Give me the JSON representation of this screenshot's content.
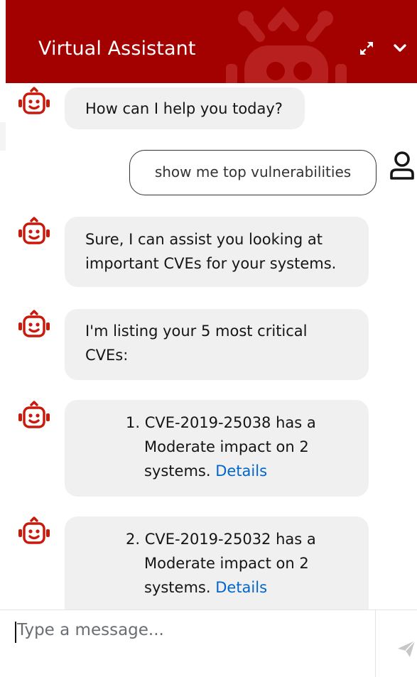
{
  "header": {
    "title": "Virtual Assistant",
    "background_color": "#a30000",
    "expand_icon": "expand-icon",
    "collapse_icon": "chevron-down-icon"
  },
  "messages": [
    {
      "sender": "bot",
      "text": "How can I help you today?"
    },
    {
      "sender": "user",
      "text": "show me top vulnerabilities"
    },
    {
      "sender": "bot",
      "lines": [
        "Sure, I can assist you looking at",
        "important CVEs for your systems."
      ]
    },
    {
      "sender": "bot",
      "lines": [
        "I'm listing your 5 most critical",
        "CVEs:"
      ]
    },
    {
      "sender": "bot",
      "lines": [
        "1. CVE-2019-25038 has a",
        "Moderate impact on 2",
        "systems."
      ],
      "link": "Details"
    },
    {
      "sender": "bot",
      "lines": [
        "2. CVE-2019-25032 has a",
        "Moderate impact on 2",
        "systems."
      ],
      "link": "Details"
    }
  ],
  "input": {
    "placeholder": "Type a message...",
    "value": ""
  },
  "colors": {
    "bot_icon": "#c9190b",
    "bubble": "#f0f0f0",
    "link": "#0066cc"
  }
}
